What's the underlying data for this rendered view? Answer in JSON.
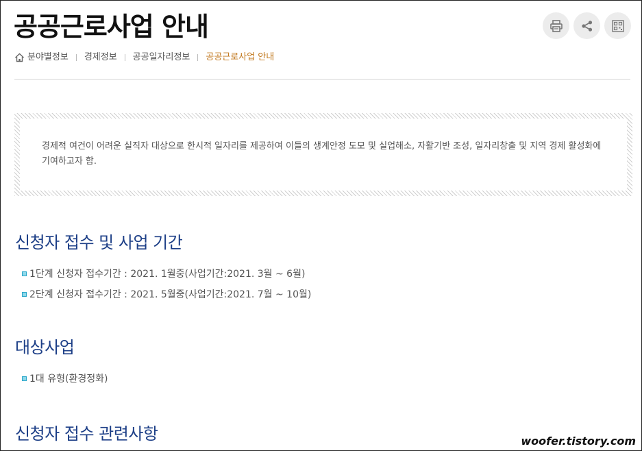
{
  "page": {
    "title": "공공근로사업 안내"
  },
  "tools": [
    {
      "name": "print-icon"
    },
    {
      "name": "share-icon"
    },
    {
      "name": "qr-code-icon"
    }
  ],
  "breadcrumb": {
    "home_icon": "home-icon",
    "items": [
      "분야별정보",
      "경제정보",
      "공공일자리정보",
      "공공근로사업 안내"
    ]
  },
  "intro": {
    "text": "경제적 여건이 어려운 실직자 대상으로 한시적 일자리를 제공하여 이들의 생계안정 도모 및 실업해소, 자활기반 조성, 일자리창출 및 지역 경제 활성화에 기여하고자 함."
  },
  "sections": [
    {
      "title": "신청자 접수 및 사업 기간",
      "items": [
        "1단계 신청자 접수기간 : 2021. 1월중(사업기간:2021. 3월 ~ 6월)",
        "2단계 신청자 접수기간 : 2021. 5월중(사업기간:2021. 7월 ~ 10월)"
      ]
    },
    {
      "title": "대상사업",
      "items": [
        "1대 유형(환경정화)"
      ]
    },
    {
      "title": "신청자 접수 관련사항",
      "items": []
    }
  ],
  "watermark": "woofer.tistory.com",
  "colors": {
    "section_title": "#1d3f87",
    "breadcrumb_current": "#c0761a",
    "bullet": "#2aa7c9"
  }
}
